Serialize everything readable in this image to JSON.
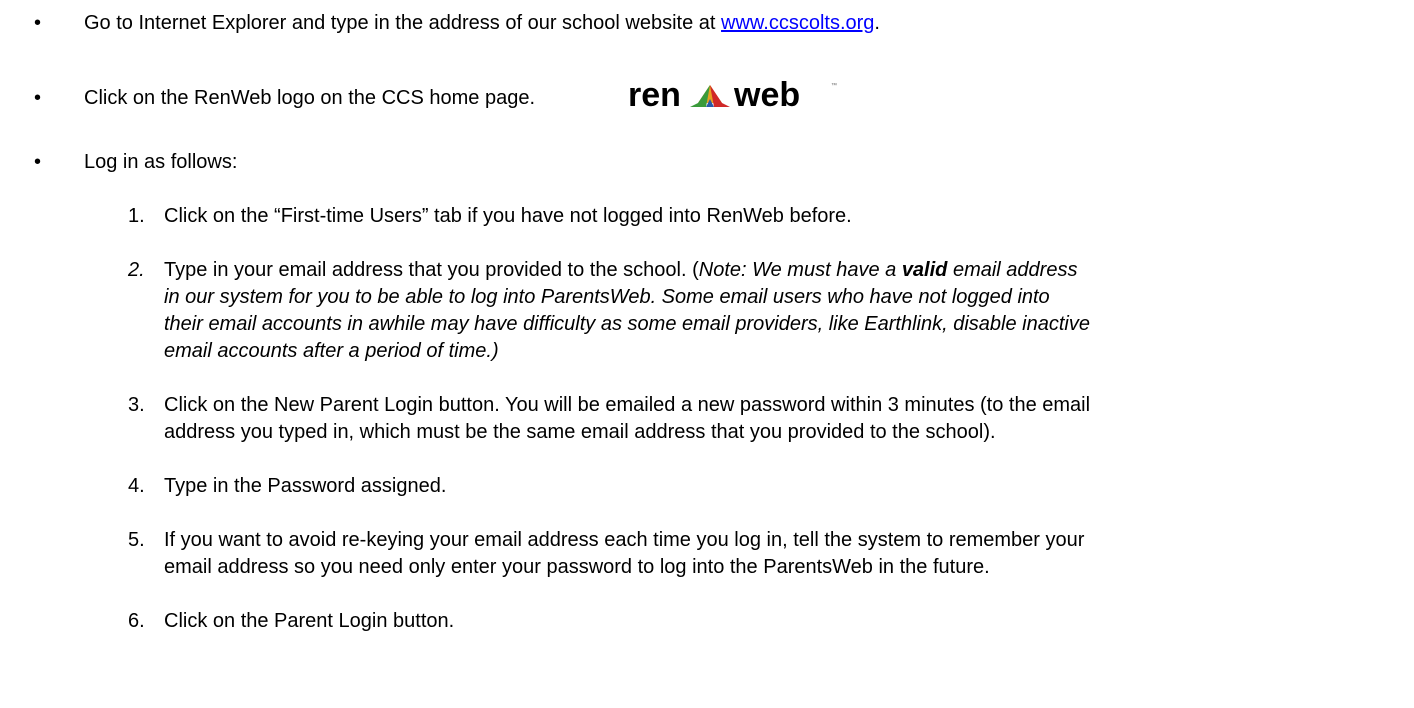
{
  "bullets": [
    {
      "text": "Go to Internet Explorer and type in the address of our school website at ",
      "link": "www.ccscolts.org",
      "after": "."
    },
    {
      "text": "Click on the RenWeb logo on the CCS home page.",
      "logo": {
        "text": "ren web",
        "colors": [
          "#e8a020",
          "#3a9a3a",
          "#d02828",
          "#2a5aa8"
        ]
      }
    },
    {
      "text": "Log in as follows:"
    }
  ],
  "steps": [
    {
      "num": "1.",
      "lines": [
        "Click on the “First-time Users” tab if you have not logged into RenWeb before."
      ]
    },
    {
      "num": "2.",
      "line1_a": "Type in your email address that you provided to the school.  (",
      "line1_b": "Note:  We must have a ",
      "line1_c": "valid",
      "line1_d": " email address",
      "italic_lines": [
        "in our system for you to be able to log into ParentsWeb.  Some email users who have not logged into",
        "their email accounts in awhile may have difficulty as some email providers, like Earthlink, disable inactive",
        "email accounts after a period of time.)"
      ]
    },
    {
      "num": "3.",
      "lines": [
        "Click on the New Parent Login button.  You will be emailed a new password within 3 minutes (to the email",
        "address you typed in, which must be the same email address that you provided to the school)."
      ]
    },
    {
      "num": "4.",
      "lines": [
        "Type in the Password assigned."
      ]
    },
    {
      "num": "5.",
      "lines": [
        "If you want to avoid re-keying your email address each time you log in, tell the system to remember your",
        "email address so you need only enter your password to log into the ParentsWeb in the future."
      ]
    },
    {
      "num": "6.",
      "lines": [
        "Click on the Parent Login button."
      ]
    }
  ]
}
